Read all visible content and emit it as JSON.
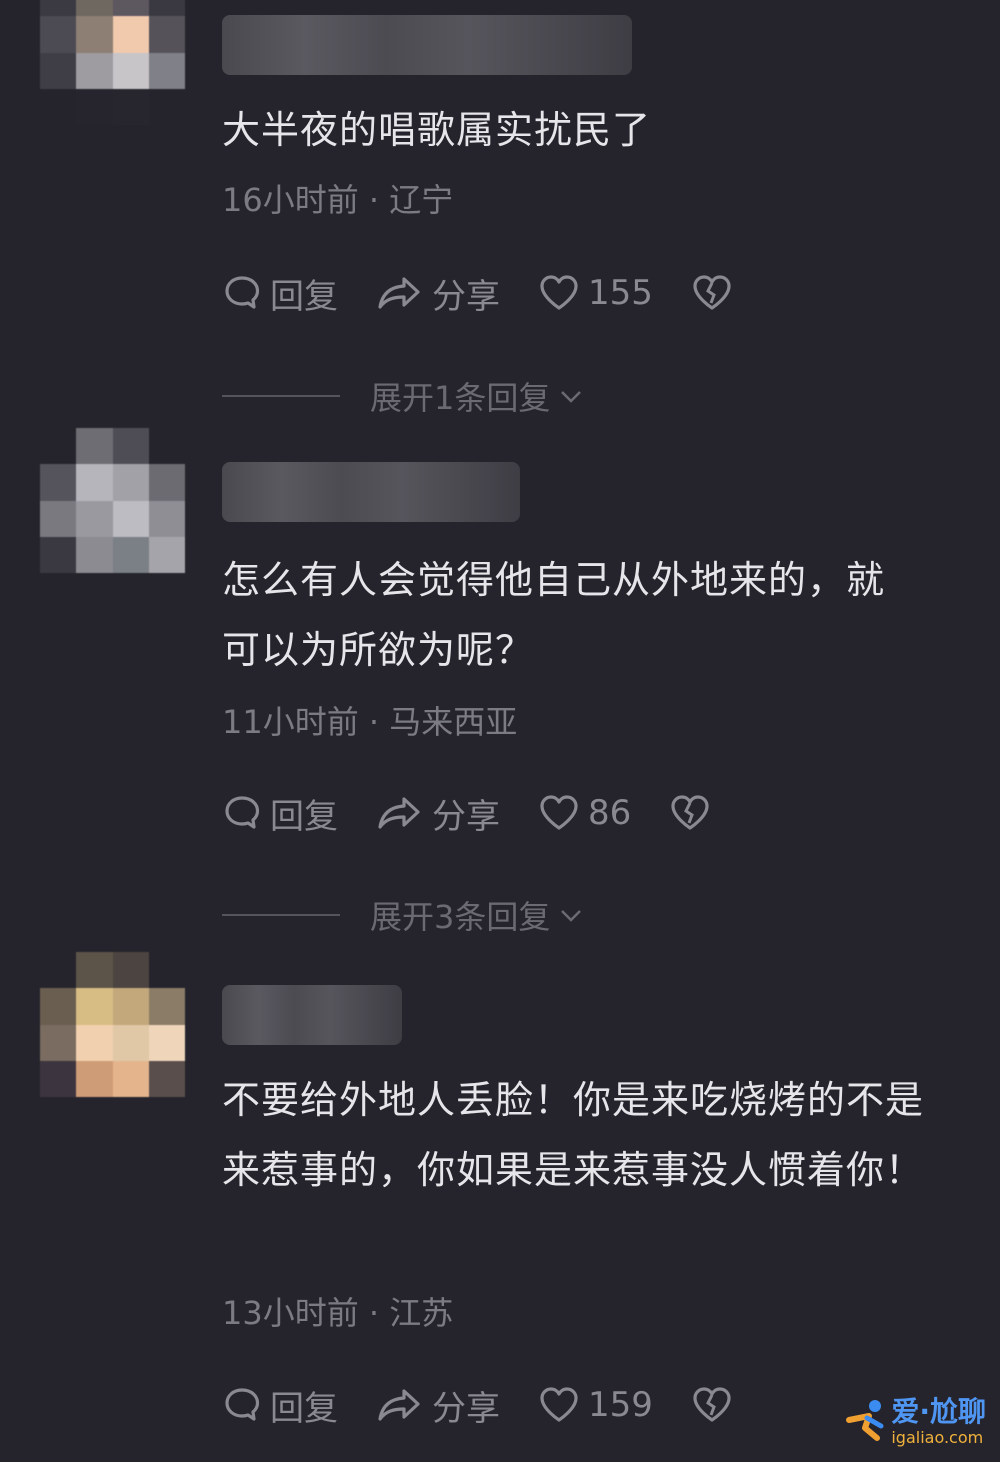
{
  "comments": [
    {
      "text": "大半夜的唱歌属实扰民了",
      "time": "16小时前",
      "location": "辽宁",
      "reply_label": "回复",
      "share_label": "分享",
      "likes": "155",
      "expand_label": "展开1条回复"
    },
    {
      "text": "怎么有人会觉得他自己从外地来的，就可以为所欲为呢？",
      "time": "11小时前",
      "location": "马来西亚",
      "reply_label": "回复",
      "share_label": "分享",
      "likes": "86",
      "expand_label": "展开3条回复"
    },
    {
      "text": "不要给外地人丢脸！你是来吃烧烤的不是来惹事的，你如果是来惹事没人惯着你！",
      "time": "13小时前",
      "location": "江苏",
      "reply_label": "回复",
      "share_label": "分享",
      "likes": "159"
    }
  ],
  "meta_separator": " · ",
  "watermark": {
    "main": "爱·尬聊",
    "sub": "igaliao.com"
  },
  "colors": {
    "background": "#25242c",
    "text": "#e6e5ea",
    "muted": "#7c7b84"
  }
}
